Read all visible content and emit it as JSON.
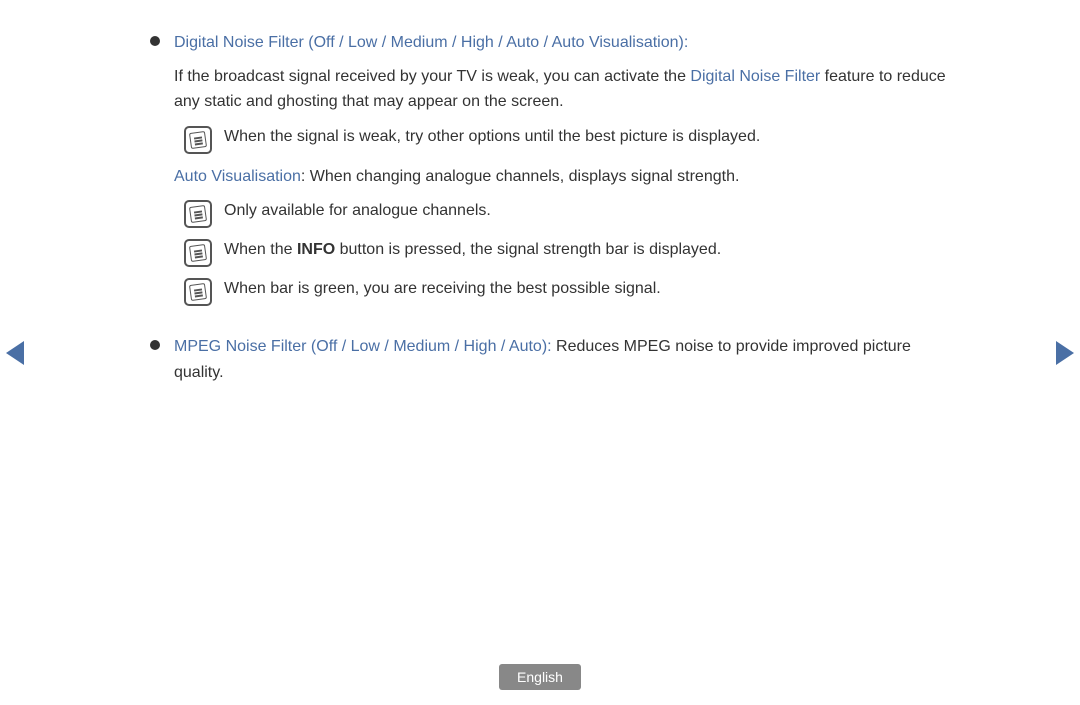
{
  "navigation": {
    "left_arrow": "◄",
    "right_arrow": "►"
  },
  "content": {
    "items": [
      {
        "id": "digital-noise-filter",
        "heading_blue": "Digital Noise Filter (Off / Low / Medium / High / Auto / Auto Visualisation):",
        "paragraph1": "If the broadcast signal received by your TV is weak, you can activate the ",
        "paragraph1_link": "Digital Noise Filter",
        "paragraph1_cont": " feature to reduce any static and ghosting that may appear on the screen.",
        "notes": [
          {
            "text": "When the signal is weak, try other options until the best picture is displayed."
          }
        ],
        "sub_heading_blue": "Auto Visualisation",
        "sub_heading_cont": ": When changing analogue channels, displays signal strength.",
        "sub_notes": [
          {
            "text": "Only available for analogue channels."
          },
          {
            "text_before": "When the ",
            "text_bold": "INFO",
            "text_after": " button is pressed, the signal strength bar is displayed."
          },
          {
            "text": "When bar is green, you are receiving the best possible signal."
          }
        ]
      },
      {
        "id": "mpeg-noise-filter",
        "heading_blue": "MPEG Noise Filter (Off / Low / Medium / High / Auto):",
        "paragraph1": " Reduces MPEG noise to provide improved picture quality."
      }
    ]
  },
  "footer": {
    "language_label": "English"
  }
}
